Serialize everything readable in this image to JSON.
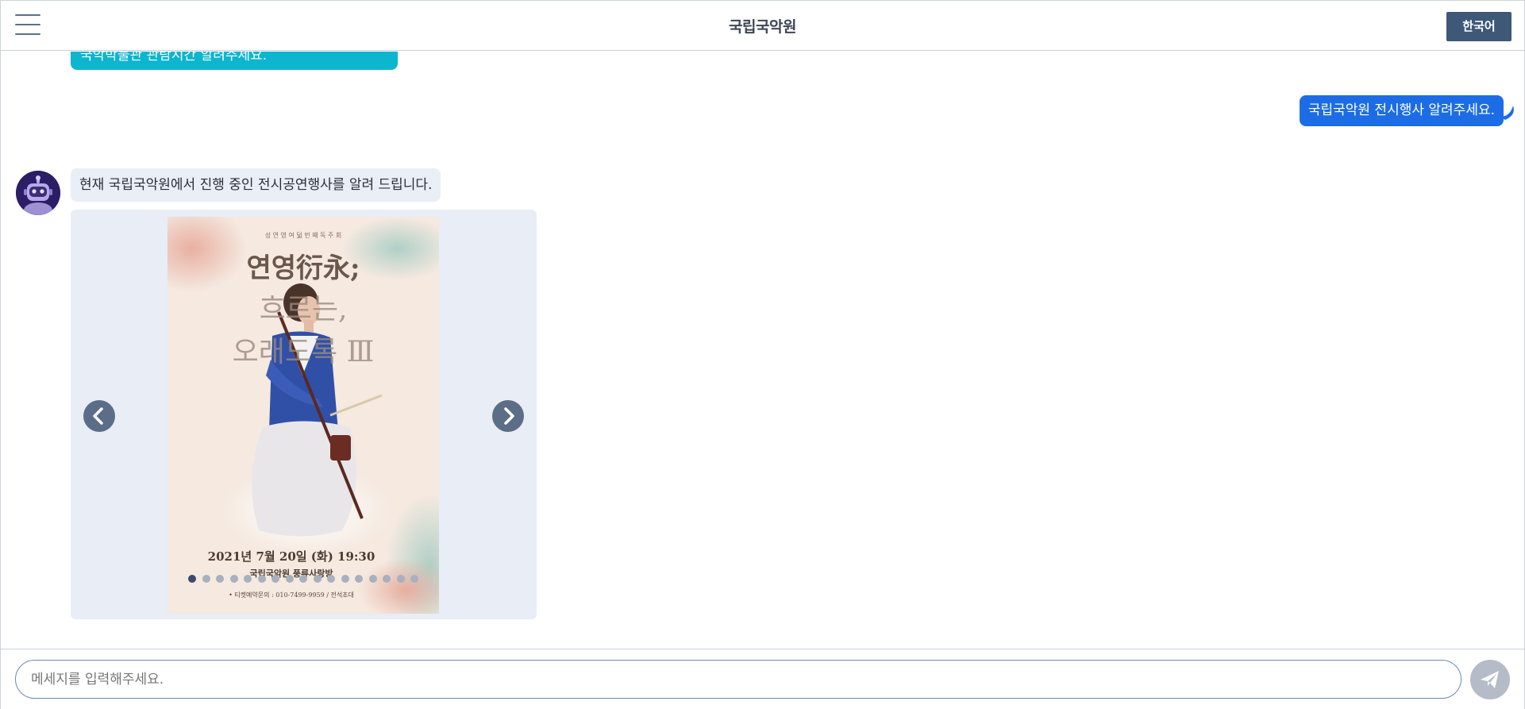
{
  "header": {
    "title": "국립국악원",
    "language_button": "한국어"
  },
  "chat": {
    "previous_bot_text": "국악박물관 관람시간 알려주세요.",
    "user_message": "국립국악원 전시행사 알려주세요.",
    "bot_message": "현재 국립국악원에서 진행 중인 전시공연행사를 알려 드립니다."
  },
  "carousel": {
    "poster": {
      "top_caption": "성 연 영   여 덟 번 째   독 주 회",
      "title_line1": "연영衍永;",
      "title_line2": "흐르는,",
      "title_line3": "오래도록 Ⅲ",
      "date": "2021년 7월 20일 (화) 19:30",
      "venue": "국립국악원 풍류사랑방",
      "ticket_info": "• 티켓예약문의 : 010-7499-9959 / 전석초대"
    },
    "slide_count": 17,
    "active_index": 0
  },
  "input": {
    "placeholder": "메세지를 입력해주세요."
  },
  "icons": {
    "menu": "hamburger-menu-icon",
    "avatar": "robot-avatar-icon",
    "prev": "chevron-left-icon",
    "next": "chevron-right-icon",
    "send": "paper-plane-icon"
  },
  "colors": {
    "header_button": "#3e5878",
    "user_bubble": "#1c6ce6",
    "prev_bot_bubble": "#0db5cf",
    "bot_bubble": "#eaeef6",
    "carousel_bg": "#e8edf6",
    "send_button": "#b5bcc7"
  }
}
